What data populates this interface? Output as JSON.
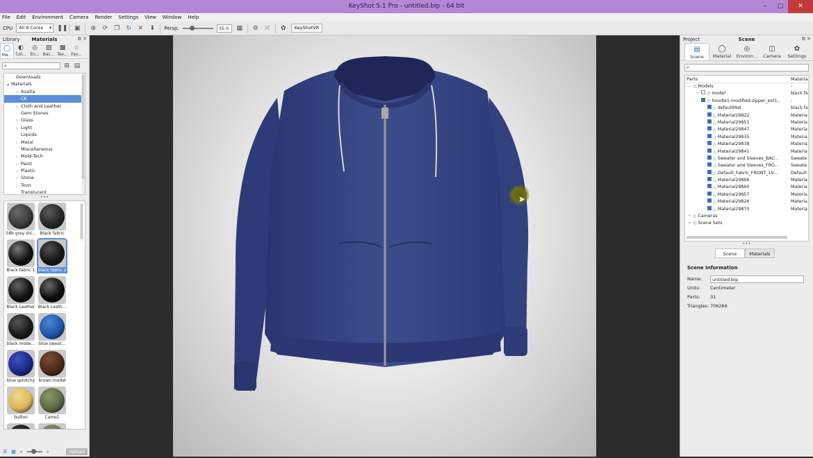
{
  "window": {
    "title": "KeyShot 5.1 Pro  -  untitled.bip  -  64 bit",
    "min": "–",
    "max": "□",
    "close": "✕"
  },
  "menu": [
    "File",
    "Edit",
    "Environment",
    "Camera",
    "Render",
    "Settings",
    "View",
    "Window",
    "Help"
  ],
  "toolbar": {
    "cpu_label": "CPU",
    "cores": "All 8 Cores",
    "persp_label": "Persp.",
    "fov": "35.0",
    "vr_label": "KeyShotVR"
  },
  "library": {
    "panel_left": "Library",
    "panel_title": "Materials",
    "tabs": [
      {
        "label": "Ma...",
        "icon": "materials-icon"
      },
      {
        "label": "Col...",
        "icon": "colors-icon"
      },
      {
        "label": "En...",
        "icon": "environments-icon"
      },
      {
        "label": "Bac...",
        "icon": "backplates-icon"
      },
      {
        "label": "Tex...",
        "icon": "textures-icon"
      },
      {
        "label": "Fav...",
        "icon": "favorites-icon"
      }
    ],
    "search_placeholder": "",
    "tree": [
      {
        "label": "Downloads",
        "arrow": false,
        "italic": true,
        "indent": 1
      },
      {
        "label": "Materials",
        "arrow": true,
        "open": true,
        "indent": 0
      },
      {
        "label": "Axalta",
        "arrow": true,
        "indent": 2
      },
      {
        "label": "CK",
        "arrow": true,
        "indent": 2,
        "selected": true
      },
      {
        "label": "Cloth and Leather",
        "arrow": true,
        "indent": 2
      },
      {
        "label": "Gem Stones",
        "arrow": false,
        "indent": 2
      },
      {
        "label": "Glass",
        "arrow": true,
        "indent": 2
      },
      {
        "label": "Light",
        "arrow": true,
        "indent": 2
      },
      {
        "label": "Liquids",
        "arrow": false,
        "indent": 2
      },
      {
        "label": "Metal",
        "arrow": true,
        "indent": 2
      },
      {
        "label": "Miscellaneous",
        "arrow": false,
        "indent": 2
      },
      {
        "label": "Mold-Tech",
        "arrow": true,
        "indent": 2
      },
      {
        "label": "Paint",
        "arrow": true,
        "indent": 2
      },
      {
        "label": "Plastic",
        "arrow": true,
        "indent": 2
      },
      {
        "label": "Stone",
        "arrow": true,
        "indent": 2
      },
      {
        "label": "Toon",
        "arrow": true,
        "indent": 2
      },
      {
        "label": "Translucent",
        "arrow": false,
        "indent": 2
      }
    ],
    "swatches": [
      {
        "label": "58b grey shi...",
        "color": "#3a3a3a",
        "hi": "#6a6a6a"
      },
      {
        "label": "Black fabric",
        "color": "#262626",
        "hi": "#5a5a5a"
      },
      {
        "label": "Black fabric 1",
        "color": "#111111",
        "hi": "#777777"
      },
      {
        "label": "black fabric 2",
        "color": "#161616",
        "hi": "#505050",
        "selected": true
      },
      {
        "label": "Black Leather",
        "color": "#121212",
        "hi": "#606060"
      },
      {
        "label": "Black Leath...",
        "color": "#0c0c0c",
        "hi": "#6a6a6a"
      },
      {
        "label": "black mode...",
        "color": "#1a1a1a",
        "hi": "#555555"
      },
      {
        "label": "blue sweat...",
        "color": "#1f57a8",
        "hi": "#4a86d4"
      },
      {
        "label": "blue splotchy",
        "color": "#1b2a8a",
        "hi": "#3a52c0"
      },
      {
        "label": "brown model",
        "color": "#4a2a18",
        "hi": "#7a4e33"
      },
      {
        "label": "button",
        "color": "#d9b85a",
        "hi": "#f0da8e"
      },
      {
        "label": "Camo1",
        "color": "#5d6a45",
        "hi": "#8a9868"
      },
      {
        "label": "",
        "color": "#141414",
        "hi": "#444444"
      },
      {
        "label": "",
        "color": "#6f7055",
        "hi": "#8e8e70"
      }
    ],
    "upload_label": "Upload"
  },
  "project": {
    "panel_left": "Project",
    "panel_title": "Scene",
    "tabs": [
      {
        "label": "Scene",
        "icon": "scene-icon"
      },
      {
        "label": "Material",
        "icon": "material-icon"
      },
      {
        "label": "Environ...",
        "icon": "environment-icon"
      },
      {
        "label": "Camera",
        "icon": "camera-icon"
      },
      {
        "label": "Settings",
        "icon": "settings-icon"
      }
    ],
    "parts_header": "Parts",
    "material_header": "Materia",
    "tree": [
      {
        "name": "Models",
        "mat": "-",
        "indent": 0,
        "check": false,
        "tri": true
      },
      {
        "name": "model",
        "mat": "black fa",
        "indent": 1,
        "check": "off"
      },
      {
        "name": "hoodie1-modified-zipper_ext1...",
        "mat": "-",
        "indent": 1,
        "check": "on"
      },
      {
        "name": "defaultMat",
        "mat": "black fa",
        "indent": 2,
        "check": "on"
      },
      {
        "name": "Material29822",
        "mat": "Materia",
        "indent": 2,
        "check": "on"
      },
      {
        "name": "Material29851",
        "mat": "Materia",
        "indent": 2,
        "check": "on"
      },
      {
        "name": "Material29847",
        "mat": "Materia",
        "indent": 2,
        "check": "on"
      },
      {
        "name": "Material29835",
        "mat": "Materia",
        "indent": 2,
        "check": "on"
      },
      {
        "name": "Material29838",
        "mat": "Materia",
        "indent": 2,
        "check": "on"
      },
      {
        "name": "Material29841",
        "mat": "Materia",
        "indent": 2,
        "check": "on"
      },
      {
        "name": "Sweater and Sleeves_BAC...",
        "mat": "Sweate",
        "indent": 2,
        "check": "on"
      },
      {
        "name": "Sweater and Sleeves_FRO...",
        "mat": "Sweate",
        "indent": 2,
        "check": "on"
      },
      {
        "name": "Default_Fabric_FRONT_19...",
        "mat": "Default",
        "indent": 2,
        "check": "on"
      },
      {
        "name": "Material29866",
        "mat": "Materia",
        "indent": 2,
        "check": "on"
      },
      {
        "name": "Material29860",
        "mat": "Materia",
        "indent": 2,
        "check": "on"
      },
      {
        "name": "Material29857",
        "mat": "Materia",
        "indent": 2,
        "check": "on"
      },
      {
        "name": "Material29826",
        "mat": "Materia",
        "indent": 2,
        "check": "on"
      },
      {
        "name": "Material29870",
        "mat": "Materia",
        "indent": 2,
        "check": "on"
      },
      {
        "name": "Cameras",
        "mat": "",
        "indent": 0,
        "check": false,
        "tri": true
      },
      {
        "name": "Scene Sets",
        "mat": "",
        "indent": 0,
        "check": false,
        "tri": true
      }
    ],
    "subtabs": [
      "Scene",
      "Materials"
    ],
    "info": {
      "title": "Scene Information",
      "name_label": "Name:",
      "name_value": "untitled.bip",
      "units_label": "Units:",
      "units_value": "Centimeter",
      "parts_label": "Parts:",
      "parts_value": "31",
      "tri_label": "Triangles:",
      "tri_value": "706266"
    }
  },
  "colors": {
    "hoodie": "#3a4a85",
    "hoodie_dark": "#26305e",
    "zipper": "#9a9a9a",
    "accent": "#1e73c8"
  }
}
